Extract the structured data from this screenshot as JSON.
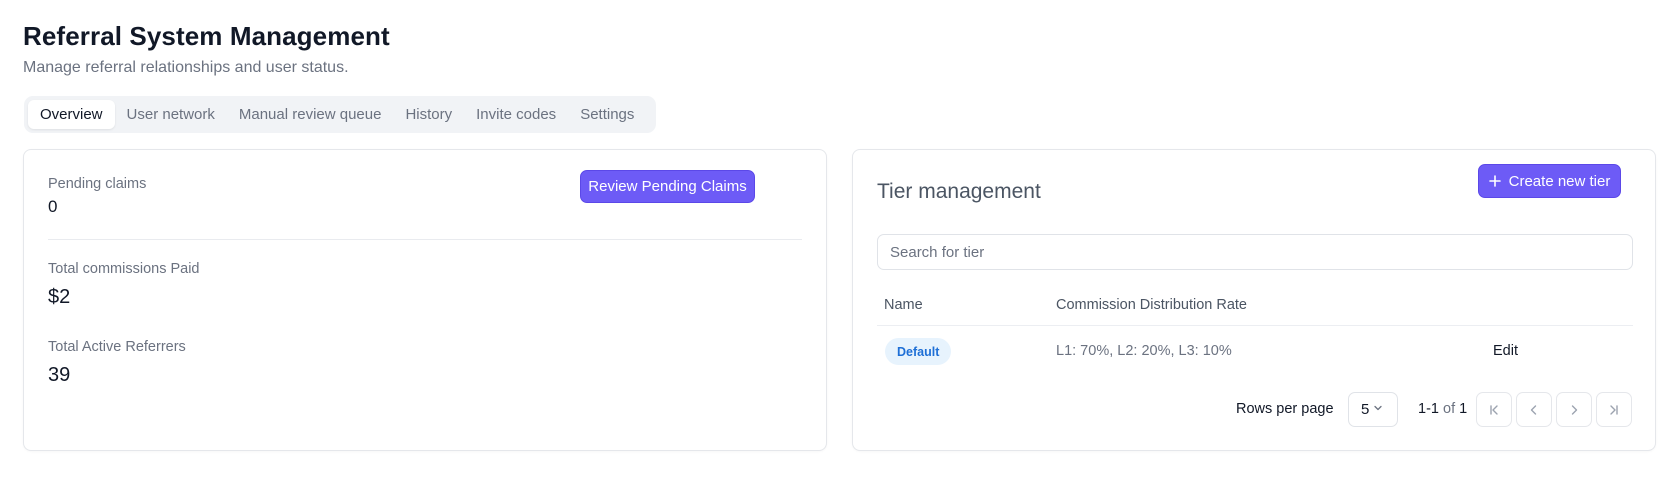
{
  "header": {
    "title": "Referral System Management",
    "subtitle": "Manage referral relationships and user status."
  },
  "tabs": [
    {
      "label": "Overview",
      "active": true
    },
    {
      "label": "User network",
      "active": false
    },
    {
      "label": "Manual review queue",
      "active": false
    },
    {
      "label": "History",
      "active": false
    },
    {
      "label": "Invite codes",
      "active": false
    },
    {
      "label": "Settings",
      "active": false
    }
  ],
  "overview": {
    "pending_label": "Pending claims",
    "pending_value": "0",
    "review_button": "Review Pending Claims",
    "commissions_label": "Total commissions Paid",
    "commissions_value": "$2",
    "referrers_label": "Total Active Referrers",
    "referrers_value": "39"
  },
  "tiers": {
    "title": "Tier management",
    "create_button": "Create new tier",
    "create_icon": "plus-icon",
    "search_placeholder": "Search for tier",
    "columns": [
      "Name",
      "Commission Distribution Rate"
    ],
    "rows": [
      {
        "name": "Default",
        "rate": "L1: 70%, L2: 20%, L3: 10%",
        "action": "Edit"
      }
    ],
    "pagination": {
      "rows_per_page_label": "Rows per page",
      "rows_per_page_value": "5",
      "range": "1-1",
      "of_label": "of",
      "total": "1"
    }
  },
  "colors": {
    "primary": "#6d5bf6",
    "badge_bg": "#e7f3fd",
    "badge_text": "#1e6fd6"
  }
}
